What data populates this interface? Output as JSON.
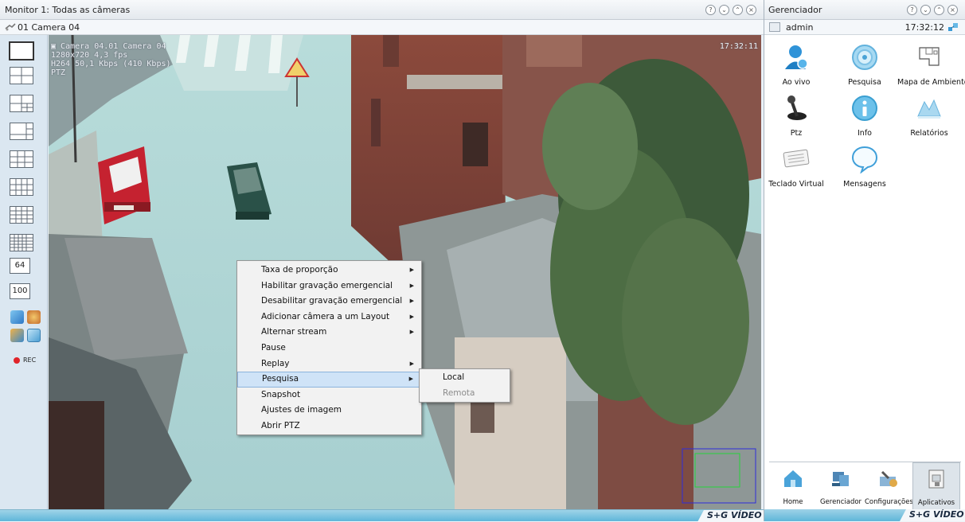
{
  "monitor": {
    "title": "Monitor 1: Todas as câmeras",
    "camera_label": "01 Camera 04",
    "overlay": {
      "line1": "Camera 04.01 Camera 04",
      "line2": "1280x720 4,3 fps",
      "line3": "H264 50,1 Kbps (410 Kbps)",
      "line4": "PTZ",
      "time": "17:32:11"
    },
    "layout_numbers": [
      "64",
      "100"
    ],
    "rec_label": "REC",
    "logo": "S+G VÍDEO"
  },
  "context_menu": {
    "items": [
      {
        "label": "Taxa de proporção",
        "submenu": true
      },
      {
        "label": "Habilitar gravação emergencial",
        "submenu": true
      },
      {
        "label": "Desabilitar gravação emergencial",
        "submenu": true
      },
      {
        "label": "Adicionar câmera a um Layout",
        "submenu": true
      },
      {
        "label": "Alternar stream",
        "submenu": true
      },
      {
        "label": "Pause",
        "submenu": false
      },
      {
        "label": "Replay",
        "submenu": true
      },
      {
        "label": "Pesquisa",
        "submenu": true,
        "highlighted": true
      },
      {
        "label": "Snapshot",
        "submenu": false
      },
      {
        "label": "Ajustes de imagem",
        "submenu": false
      },
      {
        "label": "Abrir PTZ",
        "submenu": false
      }
    ],
    "submenu": [
      {
        "label": "Local",
        "enabled": true
      },
      {
        "label": "Remota",
        "enabled": false
      }
    ]
  },
  "manager": {
    "title": "Gerenciador",
    "user": "admin",
    "clock": "17:32:12",
    "apps": [
      {
        "label": "Ao vivo",
        "icon": "live-user-icon"
      },
      {
        "label": "Pesquisa",
        "icon": "search-disc-icon"
      },
      {
        "label": "Mapa de Ambientes",
        "icon": "floor-map-icon"
      },
      {
        "label": "Ptz",
        "icon": "joystick-icon"
      },
      {
        "label": "Info",
        "icon": "info-icon"
      },
      {
        "label": "Relatórios",
        "icon": "reports-icon"
      },
      {
        "label": "Teclado Virtual",
        "icon": "keyboard-icon"
      },
      {
        "label": "Mensagens",
        "icon": "speech-bubble-icon"
      }
    ],
    "dock": [
      {
        "label": "Home",
        "icon": "home-icon"
      },
      {
        "label": "Gerenciador",
        "icon": "manager-icon"
      },
      {
        "label": "Configurações",
        "icon": "settings-icon"
      },
      {
        "label": "Aplicativos",
        "icon": "apps-icon",
        "selected": true
      }
    ],
    "logo": "S+G VÍDEO"
  },
  "colors": {
    "accent_blue": "#2e8fd0",
    "menu_highlight": "#cfe3f7",
    "rec_red": "#e0242a"
  }
}
